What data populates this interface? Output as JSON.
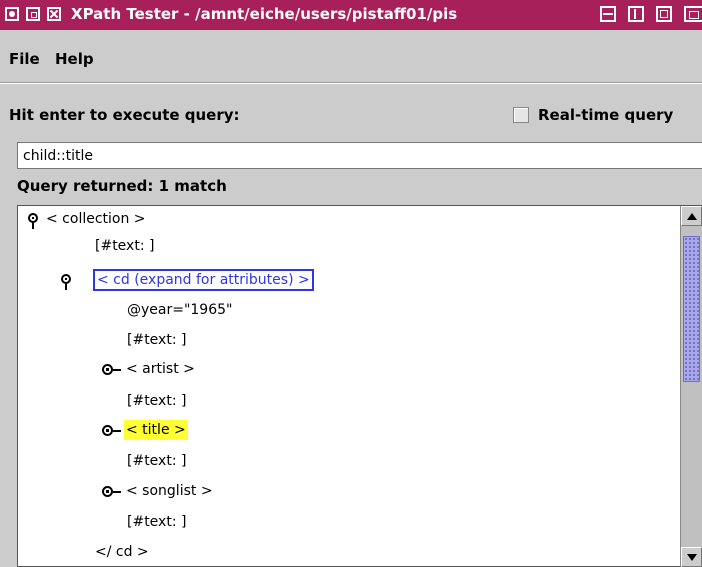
{
  "window": {
    "title": "XPath Tester - /amnt/eiche/users/pistaff01/pis"
  },
  "menu": {
    "file": "File",
    "help": "Help"
  },
  "query_panel": {
    "prompt": "Hit enter to execute query:",
    "realtime_label": "Real-time query",
    "realtime_checked": false,
    "query_value": "child::title",
    "result_label": "Query returned: 1 match"
  },
  "tree": {
    "nodes": [
      {
        "text": "< collection >",
        "marker": "pin"
      },
      {
        "text": "[#text: ]",
        "marker": "none"
      },
      {
        "text": "< cd (expand for attributes) >",
        "marker": "pin",
        "style": "boxed"
      },
      {
        "text": "@year=\"1965\"",
        "marker": "none"
      },
      {
        "text": "[#text: ]",
        "marker": "none"
      },
      {
        "text": "< artist >",
        "marker": "toggle"
      },
      {
        "text": "[#text: ]",
        "marker": "none"
      },
      {
        "text": "< title >",
        "marker": "toggle",
        "style": "highlighted"
      },
      {
        "text": "[#text: ]",
        "marker": "none"
      },
      {
        "text": "< songlist >",
        "marker": "toggle"
      },
      {
        "text": "[#text: ]",
        "marker": "none"
      },
      {
        "text": "</ cd >",
        "marker": "none"
      }
    ],
    "highlight_color": "#FFFF33",
    "selection_color": "#2E35E6"
  },
  "icons": {
    "pin": "pushpin-icon",
    "toggle": "expand-toggle-icon",
    "scroll_up": "arrow-up-icon",
    "scroll_down": "arrow-down-icon"
  },
  "colors": {
    "titlebar": "#A8205A",
    "desktop": "#FDE4A8",
    "window_bg": "#CCCCCC",
    "scroll_thumb": "#A8A8E8"
  }
}
